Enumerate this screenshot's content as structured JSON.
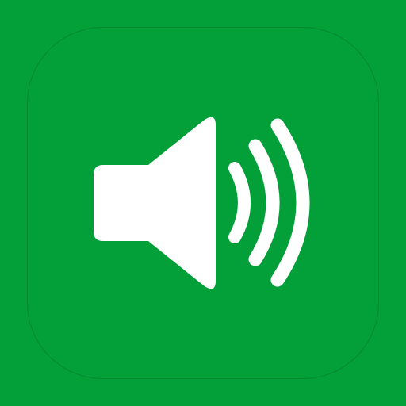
{
  "app_icon": {
    "icon": "speaker-volume-icon",
    "background_color": "#03a03a",
    "glyph_color": "#ffffff",
    "sound_wave_count": 3
  }
}
